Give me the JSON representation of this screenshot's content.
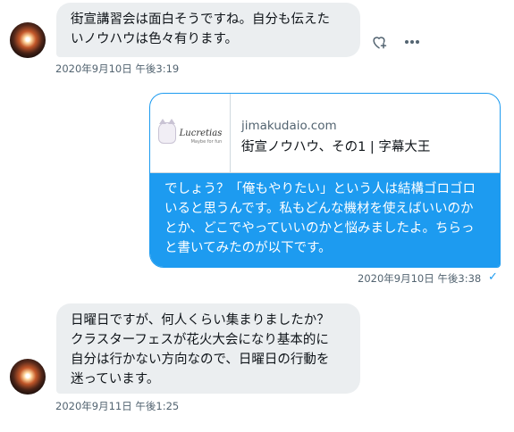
{
  "messages": [
    {
      "lines": [
        "街宣講習会は面白そうですね。自分も伝えた",
        "いノウハウは色々有ります。"
      ],
      "timestamp": "2020年9月10日 午後3:19"
    },
    {
      "card": {
        "logo_text": "Lucretias",
        "logo_subtext": "Maybe for fun",
        "domain": "jimakudaio.com",
        "title": "街宣ノウハウ、その1 | 字幕大王"
      },
      "lines": [
        "でしょう？「俺もやりたい」という人は結構ゴロゴロ",
        "いると思うんです。私もどんな機材を使えばいいのか",
        "とか、どこでやっていいのかと悩みましたよ。ちらっ",
        "と書いてみたのが以下です。"
      ],
      "timestamp": "2020年9月10日 午後3:38",
      "status_icon": "check-icon"
    },
    {
      "lines": [
        "日曜日ですが、何人くらい集まりましたか？",
        "クラスターフェスが花火大会になり基本的に",
        "自分は行かない方向なので、日曜日の行動を",
        "迷っています。"
      ],
      "timestamp": "2020年9月11日 午後1:25"
    }
  ],
  "actions": {
    "react_icon": "heart-plus-icon",
    "more_icon": "more-icon"
  },
  "colors": {
    "accent": "#1d9bf0",
    "bubble_gray": "#ebeef0",
    "meta": "#536471"
  }
}
